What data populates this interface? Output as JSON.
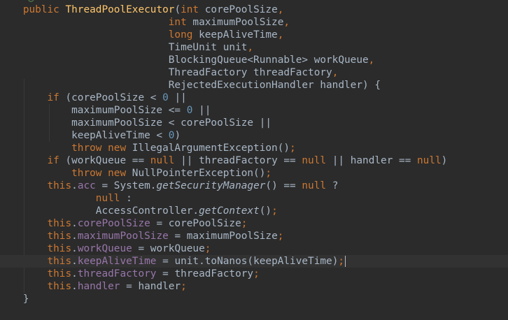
{
  "editor": {
    "theme": "darcula",
    "colors": {
      "background": "#2b2b2b",
      "current_line": "#323232",
      "default": "#a9b7c6",
      "keyword": "#cc7832",
      "method_decl": "#ffc66d",
      "field": "#9876aa",
      "number": "#6897bb",
      "italic_call": "#a9b7c6"
    },
    "lines": [
      [
        {
          "t": "  "
        },
        {
          "t": "public ",
          "k": "keyword"
        },
        {
          "t": "ThreadPoolExecutor",
          "k": "method_decl"
        },
        {
          "t": "("
        },
        {
          "t": "int ",
          "k": "keyword"
        },
        {
          "t": "corePoolSize"
        },
        {
          "t": ",",
          "k": "keyword"
        }
      ],
      [
        {
          "t": "                          "
        },
        {
          "t": "int ",
          "k": "keyword"
        },
        {
          "t": "maximumPoolSize"
        },
        {
          "t": ",",
          "k": "keyword"
        }
      ],
      [
        {
          "t": "                          "
        },
        {
          "t": "long ",
          "k": "keyword"
        },
        {
          "t": "keepAliveTime"
        },
        {
          "t": ",",
          "k": "keyword"
        }
      ],
      [
        {
          "t": "                          TimeUnit unit"
        },
        {
          "t": ",",
          "k": "keyword"
        }
      ],
      [
        {
          "t": "                          BlockingQueue<Runnable> workQueue"
        },
        {
          "t": ",",
          "k": "keyword"
        }
      ],
      [
        {
          "t": "                          ThreadFactory threadFactory"
        },
        {
          "t": ",",
          "k": "keyword"
        }
      ],
      [
        {
          "t": "                          RejectedExecutionHandler handler) {"
        }
      ],
      [
        {
          "t": "      "
        },
        {
          "t": "if ",
          "k": "keyword"
        },
        {
          "t": "(corePoolSize < "
        },
        {
          "t": "0",
          "k": "number"
        },
        {
          "t": " ||"
        }
      ],
      [
        {
          "t": "          maximumPoolSize <= "
        },
        {
          "t": "0",
          "k": "number"
        },
        {
          "t": " ||"
        }
      ],
      [
        {
          "t": "          maximumPoolSize < corePoolSize ||"
        }
      ],
      [
        {
          "t": "          keepAliveTime < "
        },
        {
          "t": "0",
          "k": "number"
        },
        {
          "t": ")"
        }
      ],
      [
        {
          "t": "          "
        },
        {
          "t": "throw new ",
          "k": "keyword"
        },
        {
          "t": "IllegalArgumentException()"
        },
        {
          "t": ";",
          "k": "keyword"
        }
      ],
      [
        {
          "t": "      "
        },
        {
          "t": "if ",
          "k": "keyword"
        },
        {
          "t": "(workQueue == "
        },
        {
          "t": "null ",
          "k": "keyword"
        },
        {
          "t": "|| threadFactory == "
        },
        {
          "t": "null ",
          "k": "keyword"
        },
        {
          "t": "|| handler == "
        },
        {
          "t": "null",
          "k": "keyword"
        },
        {
          "t": ")"
        }
      ],
      [
        {
          "t": "          "
        },
        {
          "t": "throw new ",
          "k": "keyword"
        },
        {
          "t": "NullPointerException()"
        },
        {
          "t": ";",
          "k": "keyword"
        }
      ],
      [
        {
          "t": "      "
        },
        {
          "t": "this",
          "k": "keyword"
        },
        {
          "t": "."
        },
        {
          "t": "acc",
          "k": "field"
        },
        {
          "t": " = System."
        },
        {
          "t": "getSecurityManager",
          "k": "italic_call",
          "i": true
        },
        {
          "t": "() == "
        },
        {
          "t": "null ",
          "k": "keyword"
        },
        {
          "t": "?"
        }
      ],
      [
        {
          "t": "              "
        },
        {
          "t": "null ",
          "k": "keyword"
        },
        {
          "t": ":"
        }
      ],
      [
        {
          "t": "              AccessController."
        },
        {
          "t": "getContext",
          "k": "italic_call",
          "i": true
        },
        {
          "t": "()"
        },
        {
          "t": ";",
          "k": "keyword"
        }
      ],
      [
        {
          "t": "      "
        },
        {
          "t": "this",
          "k": "keyword"
        },
        {
          "t": "."
        },
        {
          "t": "corePoolSize",
          "k": "field"
        },
        {
          "t": " = corePoolSize"
        },
        {
          "t": ";",
          "k": "keyword"
        }
      ],
      [
        {
          "t": "      "
        },
        {
          "t": "this",
          "k": "keyword"
        },
        {
          "t": "."
        },
        {
          "t": "maximumPoolSize",
          "k": "field"
        },
        {
          "t": " = maximumPoolSize"
        },
        {
          "t": ";",
          "k": "keyword"
        }
      ],
      [
        {
          "t": "      "
        },
        {
          "t": "this",
          "k": "keyword"
        },
        {
          "t": "."
        },
        {
          "t": "workQueue",
          "k": "field"
        },
        {
          "t": " = workQueue"
        },
        {
          "t": ";",
          "k": "keyword"
        }
      ],
      [
        {
          "t": "      "
        },
        {
          "t": "this",
          "k": "keyword"
        },
        {
          "t": "."
        },
        {
          "t": "keepAliveTime",
          "k": "field"
        },
        {
          "t": " = unit.toNanos(keepAliveTime)"
        },
        {
          "t": ";",
          "k": "keyword"
        }
      ],
      [
        {
          "t": "      "
        },
        {
          "t": "this",
          "k": "keyword"
        },
        {
          "t": "."
        },
        {
          "t": "threadFactory",
          "k": "field"
        },
        {
          "t": " = threadFactory"
        },
        {
          "t": ";",
          "k": "keyword"
        }
      ],
      [
        {
          "t": "      "
        },
        {
          "t": "this",
          "k": "keyword"
        },
        {
          "t": "."
        },
        {
          "t": "handler",
          "k": "field"
        },
        {
          "t": " = handler"
        },
        {
          "t": ";",
          "k": "keyword"
        }
      ],
      [
        {
          "t": "  }"
        }
      ]
    ],
    "current_line_index": 20
  }
}
